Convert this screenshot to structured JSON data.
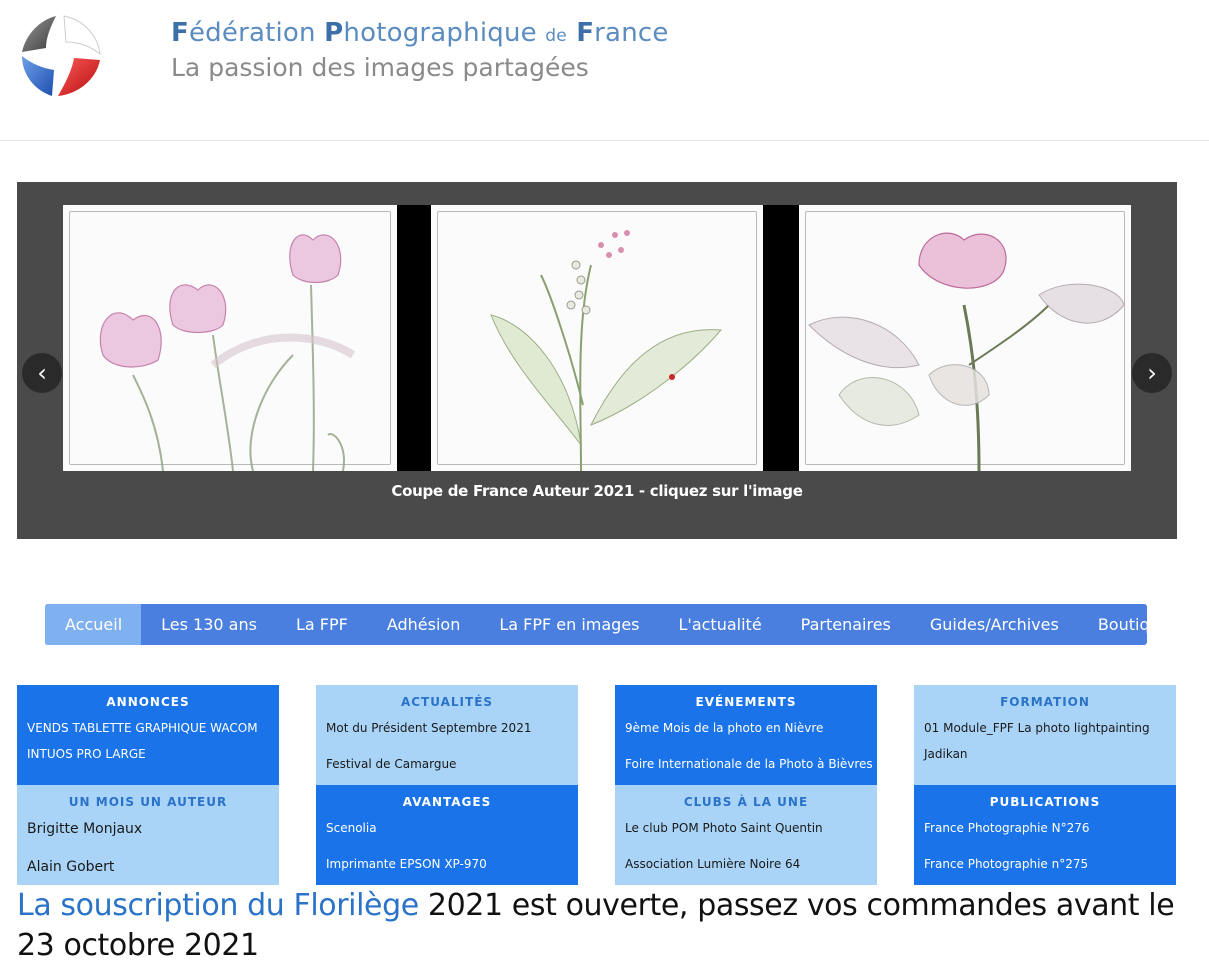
{
  "header": {
    "title_parts": [
      "F",
      "édération ",
      "P",
      "hotographique ",
      "de",
      " F",
      "rance"
    ],
    "tagline": "La passion des images partagées",
    "logo_icon": "aperture-logo-icon"
  },
  "slider": {
    "caption": "Coupe de France Auteur 2021 - cliquez sur l'image",
    "prev_icon": "chevron-left-icon",
    "next_icon": "chevron-right-icon",
    "prev_glyph": "‹",
    "next_glyph": "›"
  },
  "nav": {
    "items": [
      "Accueil",
      "Les 130 ans",
      "La FPF",
      "Adhésion",
      "La FPF en images",
      "L'actualité",
      "Partenaires",
      "Guides/Archives",
      "Boutique"
    ]
  },
  "boxes": {
    "annonces": {
      "title": "ANNONCES",
      "items": [
        "VENDS TABLETTE GRAPHIQUE WACOM INTUOS PRO LARGE"
      ]
    },
    "actualites": {
      "title": "ACTUALITÉS",
      "items": [
        "Mot du Président Septembre 2021",
        "Festival de Camargue"
      ]
    },
    "evenements": {
      "title": "EVÉNEMENTS",
      "items": [
        "9ème Mois de la photo en Nièvre",
        "Foire Internationale de la Photo à Bièvres"
      ]
    },
    "formation": {
      "title": "FORMATION",
      "items": [
        "01 Module_FPF La photo lightpainting Jadikan"
      ]
    },
    "mois_auteur": {
      "title": "UN MOIS UN AUTEUR",
      "items": [
        "Brigitte Monjaux",
        "Alain Gobert"
      ]
    },
    "avantages": {
      "title": "AVANTAGES",
      "items": [
        "Scenolia",
        "Imprimante EPSON XP-970"
      ]
    },
    "clubs": {
      "title": "CLUBS À LA UNE",
      "items": [
        "Le club POM Photo Saint Quentin",
        "Association Lumière Noire 64"
      ]
    },
    "publications": {
      "title": "PUBLICATIONS",
      "items": [
        "France Photographie N°276",
        "France Photographie n°275"
      ]
    }
  },
  "headline": {
    "link_text": "La souscription du Florilège",
    "rest_text": " 2021 est ouverte, passez vos commandes avant le 23 octobre 2021"
  },
  "colors": {
    "nav_bg": "#4a7fe0",
    "nav_active": "#7fb0f0",
    "box_dark": "#1a73e8",
    "box_light": "#a9d4f7",
    "link": "#2a73c8",
    "slider_bg": "#4a4a4a"
  }
}
